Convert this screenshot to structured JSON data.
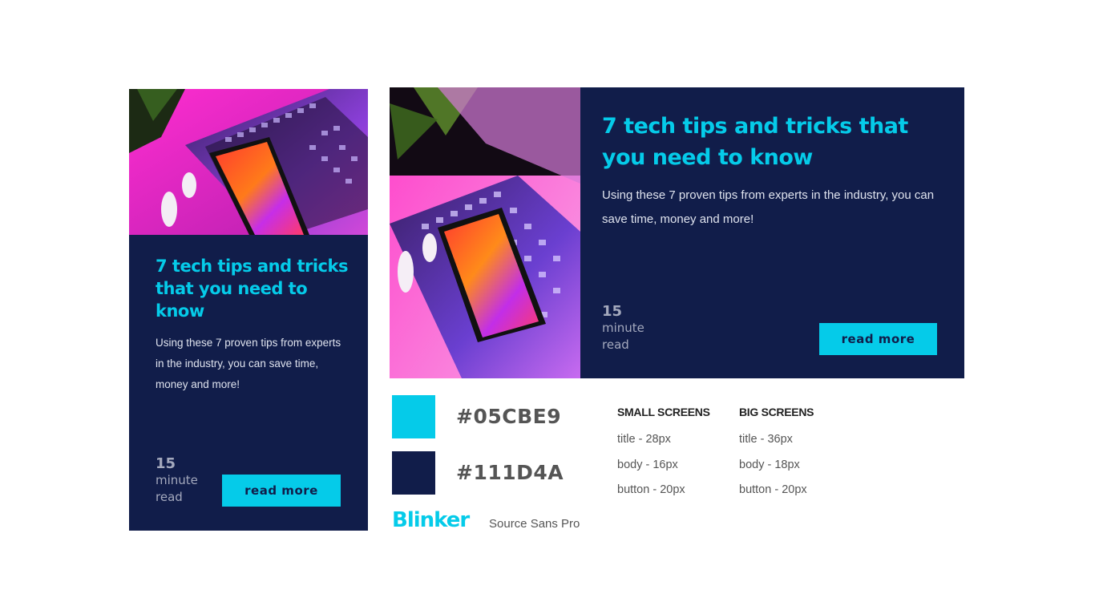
{
  "small_card": {
    "title": "7 tech tips and tricks that you need to know",
    "body": "Using these 7 proven tips from experts in the industry, you can save time, money and more!",
    "read_time_number": "15",
    "read_time_unit": "minute",
    "read_time_suffix": "read",
    "button_label": "read more"
  },
  "big_card": {
    "title": "7 tech tips and tricks that you need to know",
    "body": "Using these 7 proven tips from experts in the industry, you can save time, money and more!",
    "read_time_number": "15",
    "read_time_unit": "minute",
    "read_time_suffix": "read",
    "button_label": "read more"
  },
  "style_guide": {
    "colors": [
      {
        "hex": "#05CBE9",
        "value": "#05cbe9"
      },
      {
        "hex": "#111D4A",
        "value": "#111d4a"
      }
    ],
    "fonts": {
      "display": "Blinker",
      "body": "Source Sans Pro"
    },
    "small_screens": {
      "heading": "SMALL SCREENS",
      "rows": [
        "title - 28px",
        "body - 16px",
        "button - 20px"
      ]
    },
    "big_screens": {
      "heading": "BIG SCREENS",
      "rows": [
        "title - 36px",
        "body - 18px",
        "button - 20px"
      ]
    }
  }
}
